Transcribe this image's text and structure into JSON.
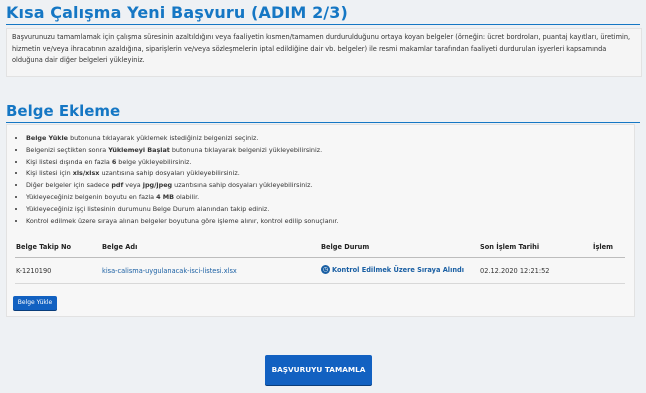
{
  "page": {
    "title": "Kısa Çalışma Yeni Başvuru (ADIM 2/3)",
    "intro": "Başvurunuzu tamamlamak için çalışma süresinin azaltıldığını veya faaliyetin kısmen/tamamen durdurulduğunu ortaya koyan belgeler (örneğin: ücret bordroları, puantaj kayıtları, üretimin, hizmetin ve/veya ihracatının azaldığına, siparişlerin ve/veya sözleşmelerin iptal edildiğine dair vb. belgeler) ile resmi makamlar tarafından faaliyeti durdurulan işyerleri kapsamında olduğuna dair diğer belgeleri yükleyiniz."
  },
  "upload_section": {
    "title": "Belge Ekleme",
    "rules": [
      [
        {
          "t": "Belge Yükle",
          "b": true
        },
        {
          "t": " butonuna tıklayarak yüklemek istediğiniz belgenizi seçiniz."
        }
      ],
      [
        {
          "t": "Belgenizi seçtikten sonra "
        },
        {
          "t": "Yüklemeyi Başlat",
          "b": true
        },
        {
          "t": " butonuna tıklayarak belgenizi yükleyebilirsiniz."
        }
      ],
      [
        {
          "t": "Kişi listesi dışında en fazla "
        },
        {
          "t": "6",
          "b": true
        },
        {
          "t": " belge yükleyebilirsiniz."
        }
      ],
      [
        {
          "t": "Kişi listesi için "
        },
        {
          "t": "xls/xlsx",
          "b": true
        },
        {
          "t": " uzantısına sahip dosyaları yükleyebilirsiniz."
        }
      ],
      [
        {
          "t": "Diğer belgeler için sadece "
        },
        {
          "t": "pdf",
          "b": true
        },
        {
          "t": " veya "
        },
        {
          "t": "jpg/jpeg",
          "b": true
        },
        {
          "t": " uzantısına sahip dosyaları yükleyebilirsiniz."
        }
      ],
      [
        {
          "t": "Yükleyeceğiniz belgenin boyutu en fazla "
        },
        {
          "t": "4 MB",
          "b": true
        },
        {
          "t": " olabilir."
        }
      ],
      [
        {
          "t": "Yükleyeceğiniz işçi listesinin durumunu Belge Durum alanından takip ediniz."
        }
      ],
      [
        {
          "t": "Kontrol edilmek üzere sıraya alınan belgeler boyutuna göre işleme alınır, kontrol edilip sonuçlanır."
        }
      ]
    ],
    "table": {
      "headers": {
        "tracking_no": "Belge Takip No",
        "name": "Belge Adı",
        "status": "Belge Durum",
        "last_action": "Son İşlem Tarihi",
        "action": "İşlem"
      },
      "rows": [
        {
          "tracking_no": "K-1210190",
          "name": "kisa-calisma-uygulanacak-isci-listesi.xlsx",
          "status": "Kontrol Edilmek Üzere Sıraya Alındı",
          "last_action": "02.12.2020 12:21:52",
          "action": ""
        }
      ]
    },
    "upload_button": "Belge Yükle"
  },
  "finish_button": "BAŞVURUYU TAMAMLA",
  "colors": {
    "accent": "#1577c4",
    "button": "#1261c1",
    "link": "#1a5fa3"
  }
}
